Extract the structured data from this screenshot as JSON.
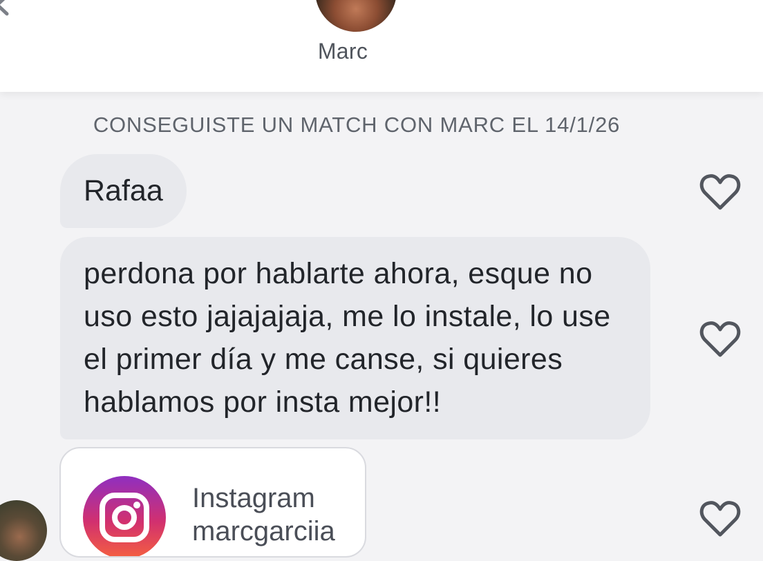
{
  "header": {
    "contact_name": "Marc"
  },
  "conversation": {
    "match_banner": "CONSEGUISTE UN MATCH CON MARC EL 14/1/26",
    "messages": [
      {
        "text": "Rafaa"
      },
      {
        "text": "perdona por hablarte ahora, esque no uso esto jajajajaja, me lo instale, lo use el primer día y me canse, si quieres hablamos por insta mejor!!"
      }
    ],
    "shared_card": {
      "title": "Instagram",
      "handle": "marcgarciia"
    }
  },
  "icons": {
    "back": "chevron-left-icon",
    "like": "heart-outline-icon",
    "instagram": "instagram-logo-icon"
  },
  "colors": {
    "bubble_bg": "#e8e9ed",
    "heart_stroke": "#52565e",
    "instagram_gradient_start": "#8f2fc0",
    "instagram_gradient_end": "#f56040"
  }
}
